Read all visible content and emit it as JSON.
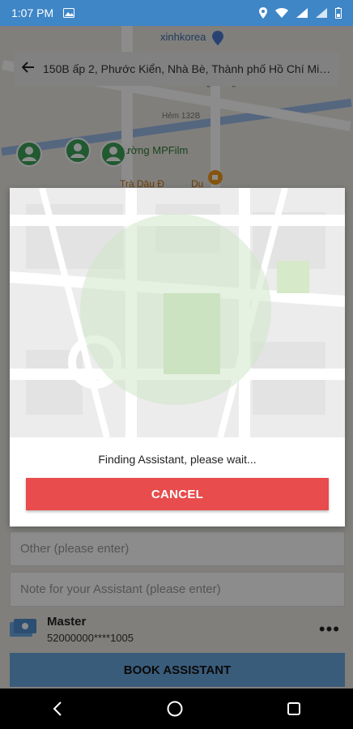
{
  "status_bar": {
    "time": "1:07 PM"
  },
  "search": {
    "address": "150B ấp 2, Phước Kiển, Nhà Bè, Thành phố Hồ Chí Min..."
  },
  "map_labels": {
    "poi1": "xinhkorea",
    "poi2": "Đình Long Kiểng",
    "poi3": "Hẻm 132B",
    "poi4": "Tường MPFilm",
    "poi5": "Trà Dâu Đ",
    "poi6": "Du"
  },
  "modal": {
    "message": "Finding Assistant, please wait...",
    "cancel_label": "CANCEL"
  },
  "form": {
    "other_placeholder": "Other (please enter)",
    "note_placeholder": "Note for your Assistant (please enter)",
    "payment_name": "Master",
    "payment_number": "52000000****1005",
    "more_glyph": "•••",
    "book_label": "BOOK ASSISTANT"
  },
  "colors": {
    "status_bar": "#3f86c7",
    "cancel_button": "#e84c4c",
    "book_button": "#6aa8e0",
    "map_green_circle": "#cfe6c8"
  }
}
